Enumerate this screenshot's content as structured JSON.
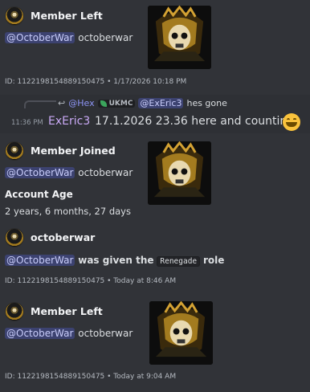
{
  "embed1": {
    "author": "Member Left",
    "mention": "@OctoberWar",
    "username": "octoberwar",
    "footer": "ID: 1122198154889150475 • 1/17/2026 10:18 PM"
  },
  "reply": {
    "reply_mention": "@Hex",
    "tag": "UKMC",
    "mention2": "@ExEric3",
    "reply_text": "hes gone",
    "time": "11:36 PM",
    "author": "ExEric3",
    "text": "17.1.2026 23.36 here and counting",
    "emoji": "grinning-face-emoji"
  },
  "embed2": {
    "author": "Member Joined",
    "mention": "@OctoberWar",
    "username": "octoberwar",
    "field_name": "Account Age",
    "field_value": "2 years, 6 months, 27 days"
  },
  "embed3": {
    "author": "octoberwar",
    "mention": "@OctoberWar",
    "text_mid": "was given the",
    "role": "Renegade",
    "text_end": "role",
    "footer": "ID: 1122198154889150475 • Today at 8:46 AM"
  },
  "embed4": {
    "author": "Member Left",
    "mention": "@OctoberWar",
    "username": "octoberwar",
    "footer": "ID: 1122198154889150475 • Today at 9:04 AM"
  }
}
